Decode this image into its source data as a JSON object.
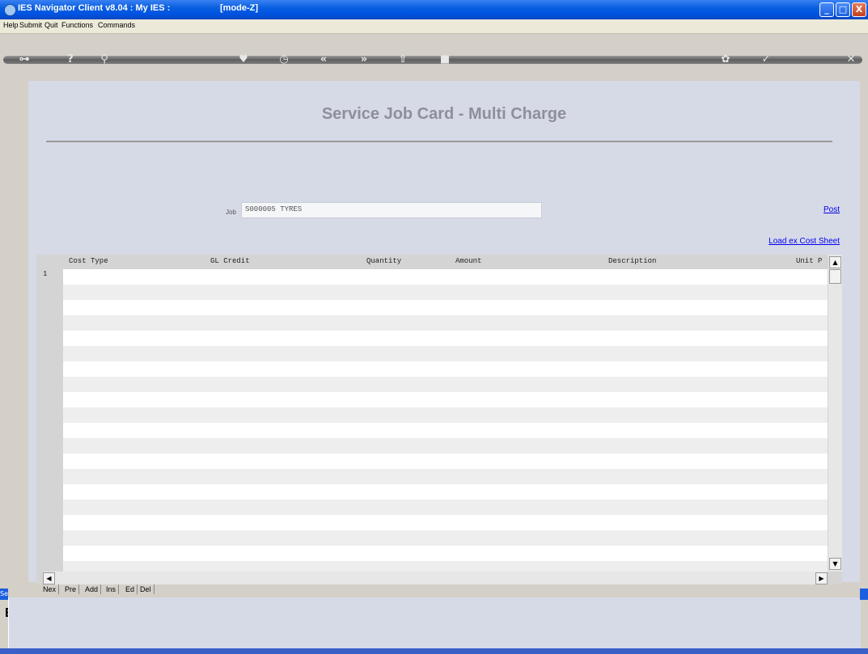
{
  "window": {
    "title": "IES Navigator Client v8.04 : My IES :",
    "mode": "[mode-Z]",
    "controls": {
      "minimize": "_",
      "maximize": "□",
      "close": "X"
    }
  },
  "menu": [
    "Help",
    "Submit",
    "Quit",
    "Functions",
    "Commands"
  ],
  "toolbar_icons": [
    "key-icon",
    "help-icon",
    "search-icon",
    "heart-icon",
    "clock-icon",
    "rewind-icon",
    "forward-icon",
    "upload-icon",
    "stop-icon",
    "gear-icon",
    "check-icon",
    "close-icon"
  ],
  "page": {
    "title": "Service Job Card - Multi Charge",
    "job_label": "Job",
    "job_value": "S000005 TYRES",
    "post_link": "Post",
    "load_link": "Load ex Cost Sheet"
  },
  "grid": {
    "columns": [
      "Cost Type",
      "GL Credit",
      "Quantity",
      "Amount",
      "Description",
      "Unit P"
    ],
    "row_numbers": [
      "1"
    ]
  },
  "nav_buttons": [
    "Nex",
    "Pre",
    "Add",
    "Ins",
    "Ed",
    "Del"
  ],
  "left_stub": {
    "tab": "Se",
    "text": "E"
  }
}
